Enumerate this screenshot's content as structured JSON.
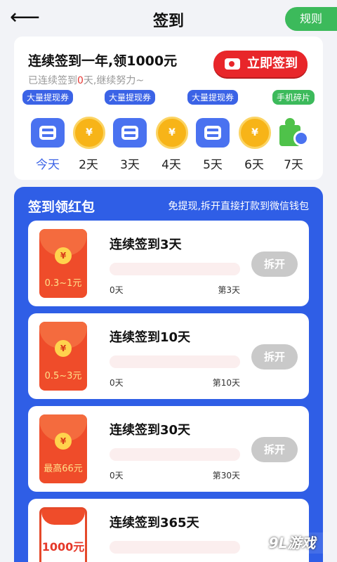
{
  "header": {
    "title": "签到",
    "rules_label": "规则"
  },
  "signin_card": {
    "title": "连续签到一年,领1000元",
    "sub_prefix": "已连续签到",
    "sub_days": "0",
    "sub_suffix": "天,继续努力~",
    "button_label": "立即签到",
    "days": [
      {
        "label": "今天",
        "reward": "ticket",
        "badge": "大量提现券",
        "today": true
      },
      {
        "label": "2天",
        "reward": "coin",
        "coin_text": "¥"
      },
      {
        "label": "3天",
        "reward": "ticket",
        "badge": "大量提现券"
      },
      {
        "label": "4天",
        "reward": "coin",
        "coin_text": "¥"
      },
      {
        "label": "5天",
        "reward": "ticket",
        "badge": "大量提现券"
      },
      {
        "label": "6天",
        "reward": "coin",
        "coin_text": "¥"
      },
      {
        "label": "7天",
        "reward": "puzzle",
        "badge": "手机碎片"
      }
    ]
  },
  "red_panel": {
    "title": "签到领红包",
    "note": "免提现,拆开直接打款到微信钱包",
    "tasks": [
      {
        "title": "连续签到3天",
        "amount": "0.3~1元",
        "start": "0天",
        "end": "第3天",
        "open_label": "拆开",
        "seal": "¥",
        "progress": 0
      },
      {
        "title": "连续签到10天",
        "amount": "0.5~3元",
        "start": "0天",
        "end": "第10天",
        "open_label": "拆开",
        "seal": "¥",
        "progress": 0
      },
      {
        "title": "连续签到30天",
        "amount": "最高66元",
        "start": "0天",
        "end": "第30天",
        "open_label": "拆开",
        "seal": "¥",
        "progress": 0
      },
      {
        "title": "连续签到365天",
        "amount": "1000元",
        "start": "",
        "end": "",
        "open_label": "",
        "seal": "",
        "progress": 0
      }
    ]
  },
  "watermark": "9L游戏"
}
